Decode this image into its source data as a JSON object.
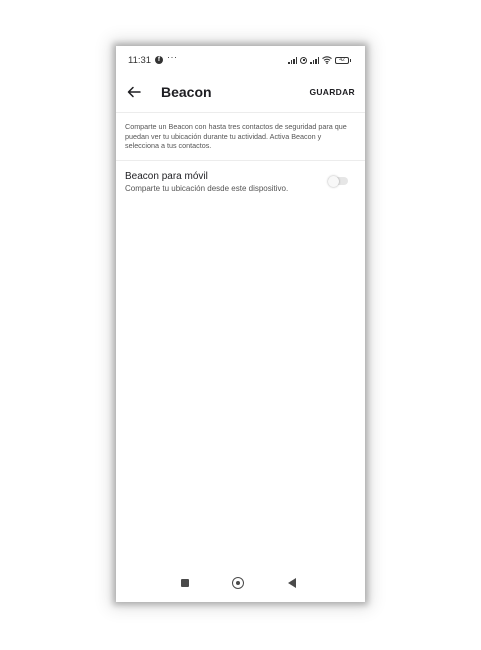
{
  "status_bar": {
    "time": "11:31",
    "facebook_badge": "f",
    "more_notifications": "···",
    "battery_level": "42"
  },
  "toolbar": {
    "title": "Beacon",
    "save_label": "GUARDAR",
    "back_icon": "arrow-left-icon"
  },
  "description": "Comparte un Beacon con hasta tres contactos de seguridad para que puedan ver tu ubicación durante tu actividad. Activa Beacon y selecciona a tus contactos.",
  "settings": [
    {
      "title": "Beacon para móvil",
      "subtitle": "Comparte tu ubicación desde este dispositivo.",
      "enabled": false
    }
  ],
  "nav_bar": {
    "icons": [
      "square-recents-icon",
      "circle-home-icon",
      "triangle-back-icon"
    ]
  },
  "colors": {
    "text_primary": "#1e1e22",
    "text_secondary": "#555555",
    "toggle_off_track": "#e6e6e6",
    "divider": "#ececec"
  }
}
